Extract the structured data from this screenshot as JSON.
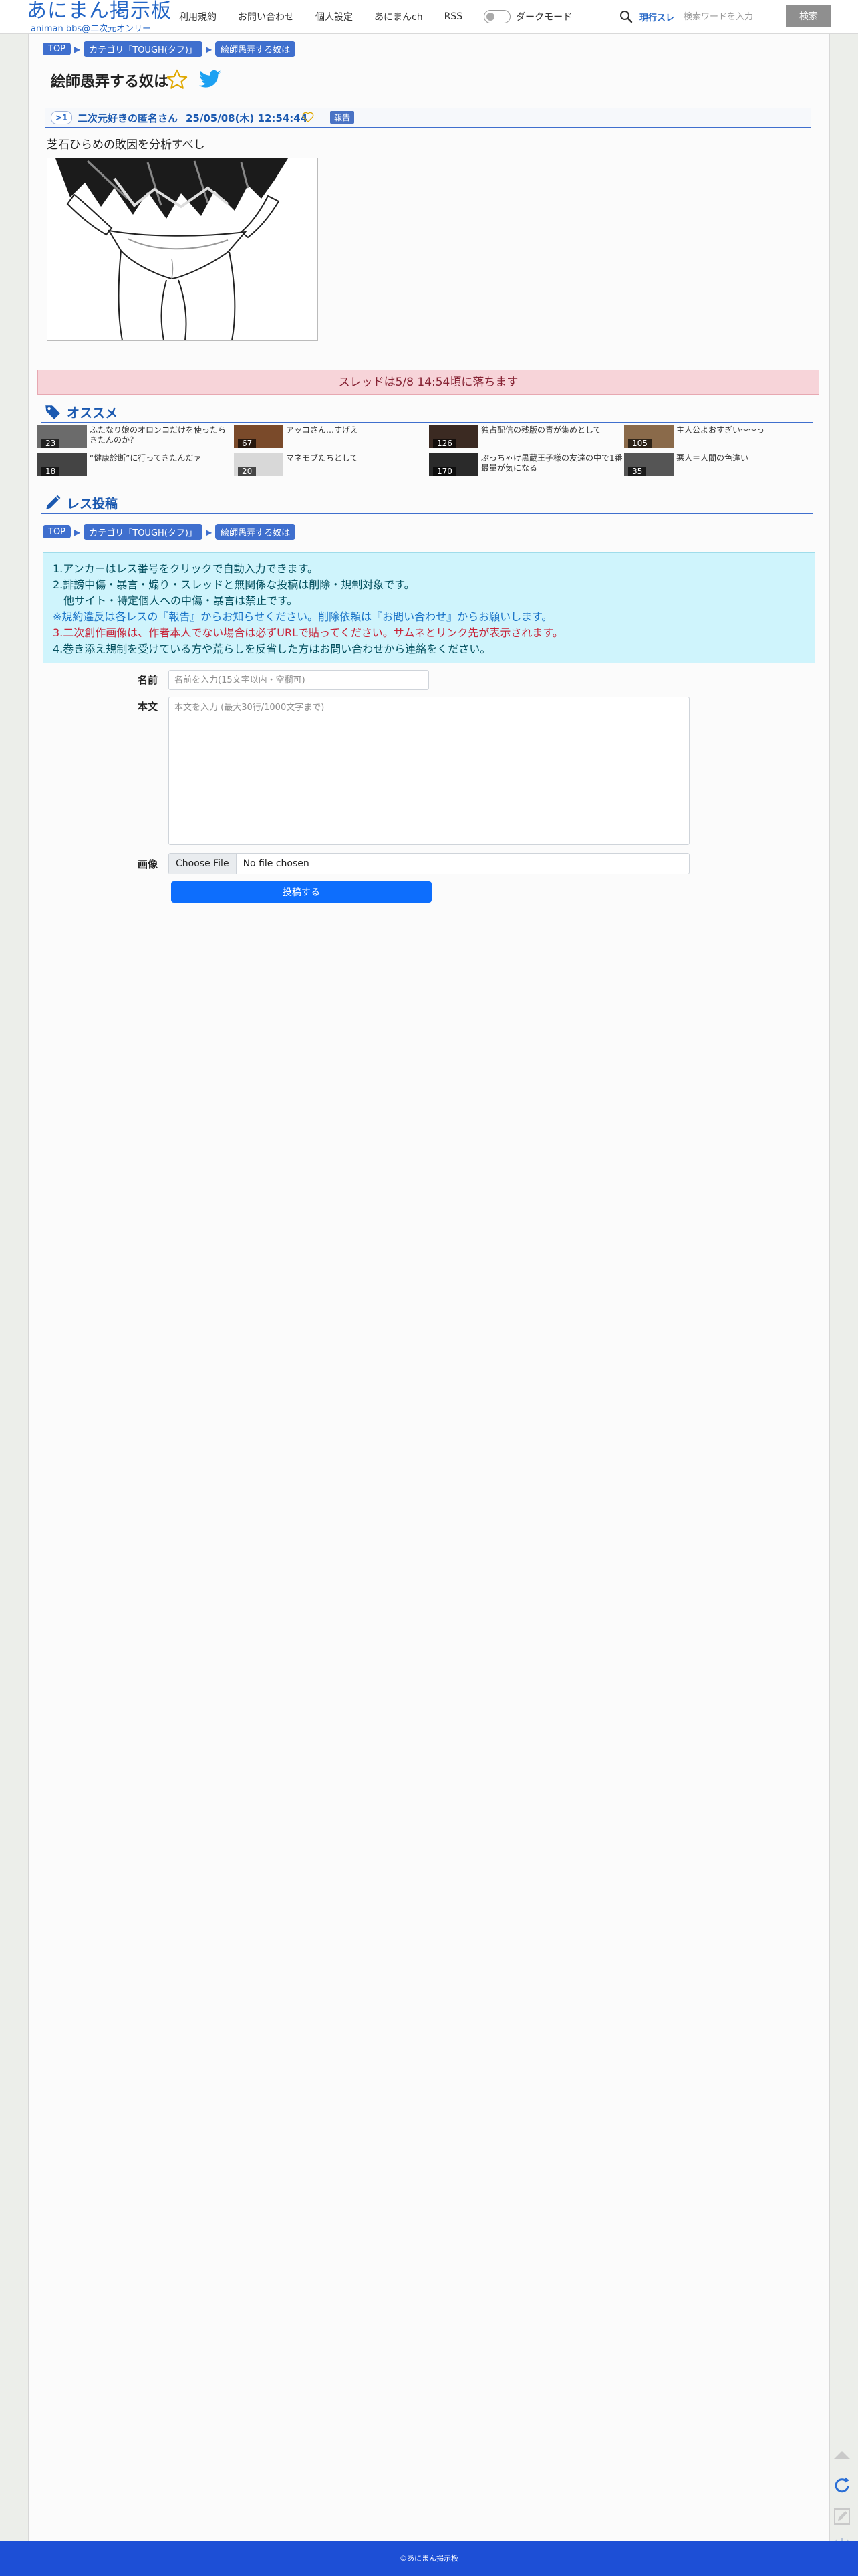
{
  "site": {
    "logo_main": "あにまん掲示板",
    "logo_sub": "animan bbs@二次元オンリー"
  },
  "nav": {
    "items": [
      "利用規約",
      "お問い合わせ",
      "個人設定",
      "あにまんch",
      "RSS"
    ],
    "dark_mode_label": "ダークモード",
    "dark_mode_on": false
  },
  "search": {
    "scope": "現行スレ",
    "placeholder": "検索ワードを入力",
    "button": "検索"
  },
  "breadcrumb": {
    "top": "TOP",
    "category": "カテゴリ「TOUGH(タフ)」",
    "current": "絵師愚弄する奴は"
  },
  "thread": {
    "title": "絵師愚弄する奴は"
  },
  "post": {
    "number": ">1",
    "name": "二次元好きの匿名さん",
    "date": "25/05/08(木) 12:54:44",
    "report": "報告",
    "body": "芝石ひらめの敗因を分析すべし"
  },
  "expiry_notice": "スレッドは5/8 14:54頃に落ちます",
  "recommend": {
    "heading": "オススメ",
    "items": [
      {
        "title": "ふたなり娘のオロンコだけを使ったら\nきたんのか？",
        "count": "23"
      },
      {
        "title": "アッコさん…すげえ",
        "count": "67"
      },
      {
        "title": "独占配信の残版の青が集めとして",
        "count": "126"
      },
      {
        "title": "主人公よおすぎい〜〜っ",
        "count": "105"
      },
      {
        "title": "“健康診断”に行ってきたんだァ",
        "count": "18"
      },
      {
        "title": "マネモブたちとして",
        "count": "20"
      },
      {
        "title": "ぶっちゃけ黒蔵王子様の友達の中で1番\n最量が気になる",
        "count": "170"
      },
      {
        "title": "悪人＝人間の色違い",
        "count": "35"
      }
    ]
  },
  "reply": {
    "heading": "レス投稿",
    "rules": [
      "1.アンカーはレス番号をクリックで自動入力できます。",
      "2.誹謗中傷・暴言・煽り・スレッドと無関係な投稿は削除・規制対象です。",
      "他サイト・特定個人への中傷・暴言は禁止です。",
      "※規約違反は各レスの『報告』からお知らせください。削除依頼は『お問い合わせ』からお願いします。",
      "3.二次創作画像は、作者本人でない場合は必ずURLで貼ってください。サムネとリンク先が表示されます。",
      "4.巻き添え規制を受けている方や荒らしを反省した方はお問い合わせから連絡をください。"
    ],
    "name_label": "名前",
    "name_placeholder": "名前を入力(15文字以内・空欄可)",
    "body_label": "本文",
    "body_placeholder": "本文を入力 (最大30行/1000文字まで)",
    "image_label": "画像",
    "file_button": "Choose File",
    "file_status": "No file chosen",
    "submit": "投稿する"
  },
  "footer": {
    "copyright": "©あにまん掲示板"
  },
  "colors": {
    "accent": "#3f6fce",
    "link": "#1b59b0",
    "alert_bg": "#f7d4d9",
    "info_bg": "#cff4fc",
    "submit": "#0d6efd",
    "footer": "#1d4fd6"
  },
  "icons": [
    "search-icon",
    "star-icon",
    "twitter-bird-icon",
    "heart-icon",
    "tag-icon",
    "pencil-icon",
    "scroll-top-icon",
    "reload-icon",
    "edit-icon",
    "gear-icon"
  ]
}
